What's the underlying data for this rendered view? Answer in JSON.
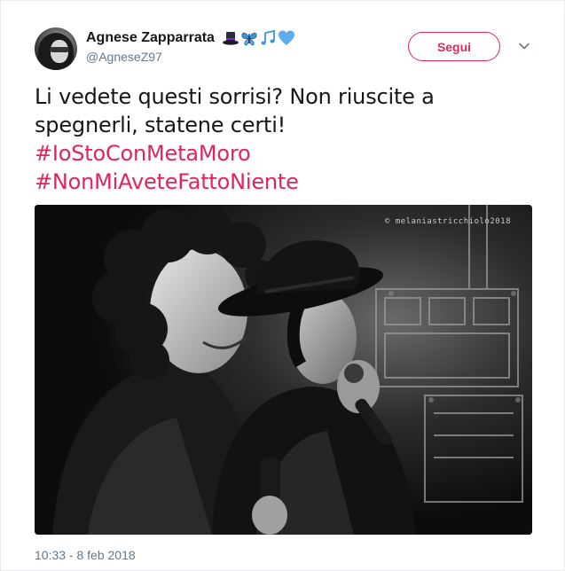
{
  "tweet": {
    "display_name": "Agnese Zapparrata",
    "emojis": [
      "top-hat-emoji",
      "butterfly-emoji",
      "music-notes-emoji",
      "blue-heart-emoji"
    ],
    "handle": "@AgneseZ97",
    "follow_label": "Segui",
    "text_line": "Li vedete questi sorrisi? Non riuscite a spegnerli, statene certi!",
    "hashtags": [
      "#IoStoConMetaMoro",
      "#NonMiAveteFattoNiente"
    ],
    "media": {
      "watermark": "© melaniastricchiolo2018"
    },
    "timestamp": "10:33 - 8 feb 2018"
  },
  "colors": {
    "accent": "#e0245e",
    "text": "#14171a",
    "muted": "#657786",
    "border": "#e6ecf0"
  }
}
